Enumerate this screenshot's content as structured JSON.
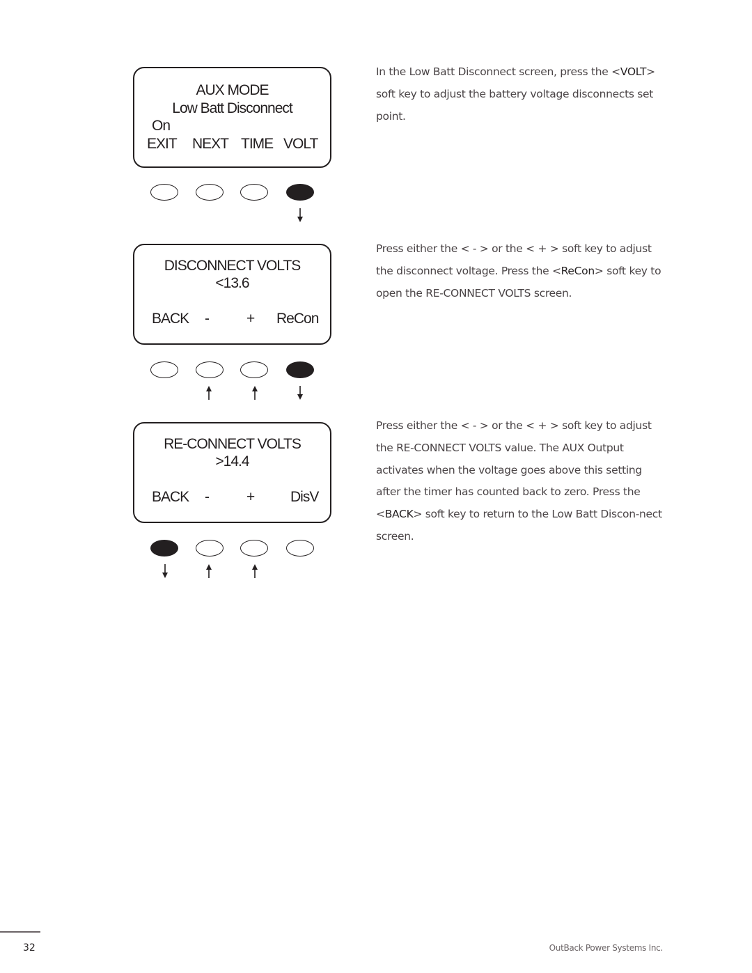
{
  "screens": [
    {
      "lines": [
        "AUX MODE",
        "Low Batt Disconnect",
        "On"
      ],
      "softkeys": [
        "EXIT",
        "NEXT",
        "TIME",
        "VOLT"
      ],
      "pressed": [
        false,
        false,
        false,
        true
      ],
      "arrows": [
        "",
        "",
        "",
        "down"
      ]
    },
    {
      "lines": [
        "DISCONNECT VOLTS",
        "<13.6"
      ],
      "softkeys": [
        "BACK",
        "-",
        "+",
        "ReCon"
      ],
      "pressed": [
        false,
        false,
        false,
        true
      ],
      "arrows": [
        "",
        "up",
        "up",
        "down"
      ]
    },
    {
      "lines": [
        "RE-CONNECT VOLTS",
        ">14.4"
      ],
      "softkeys": [
        "BACK",
        "-",
        "+",
        "DisV"
      ],
      "pressed": [
        true,
        false,
        false,
        false
      ],
      "arrows": [
        "down",
        "up",
        "up",
        ""
      ]
    }
  ],
  "paragraphs": [
    {
      "parts": [
        "In the Low Batt Disconnect screen, press the <",
        "VOLT",
        "> soft key to adjust the battery voltage disconnects set point."
      ]
    },
    {
      "parts": [
        "Press either the < - > or the < + > soft key to adjust the disconnect voltage. Press the <",
        "ReCon",
        "> soft key to open the RE-CONNECT VOLTS screen."
      ]
    },
    {
      "parts": [
        "Press either the < - > or the < + > soft key to adjust the RE-CONNECT VOLTS value. The AUX Output activates when the voltage goes above this setting after the timer has counted back to zero. Press the <",
        "BACK",
        "> soft key to return to the Low Batt Discon-nect screen."
      ]
    }
  ],
  "footer": {
    "page_number": "32",
    "company": "OutBack Power Systems Inc."
  }
}
